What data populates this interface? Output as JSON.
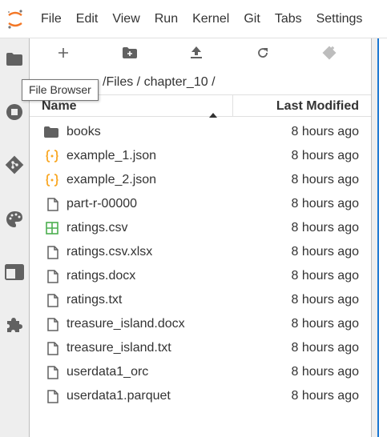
{
  "menubar": {
    "items": [
      "File",
      "Edit",
      "View",
      "Run",
      "Kernel",
      "Git",
      "Tabs",
      "Settings"
    ]
  },
  "sidebar": {
    "icons": [
      "folder-icon",
      "stop-circle-icon",
      "git-icon",
      "palette-icon",
      "tabs-icon",
      "extension-puzzle-icon"
    ]
  },
  "tooltip": {
    "text": "File Browser"
  },
  "toolbar": {
    "icons": [
      "new-launcher-icon",
      "new-folder-icon",
      "upload-icon",
      "refresh-icon",
      "git-clone-icon"
    ]
  },
  "breadcrumb": {
    "path": "/Files / chapter_10 /"
  },
  "listing": {
    "header": {
      "name": "Name",
      "modified": "Last Modified"
    },
    "files": [
      {
        "name": "books",
        "modified": "8 hours ago",
        "type": "folder"
      },
      {
        "name": "example_1.json",
        "modified": "8 hours ago",
        "type": "json"
      },
      {
        "name": "example_2.json",
        "modified": "8 hours ago",
        "type": "json"
      },
      {
        "name": "part-r-00000",
        "modified": "8 hours ago",
        "type": "file"
      },
      {
        "name": "ratings.csv",
        "modified": "8 hours ago",
        "type": "csv"
      },
      {
        "name": "ratings.csv.xlsx",
        "modified": "8 hours ago",
        "type": "file"
      },
      {
        "name": "ratings.docx",
        "modified": "8 hours ago",
        "type": "file"
      },
      {
        "name": "ratings.txt",
        "modified": "8 hours ago",
        "type": "file"
      },
      {
        "name": "treasure_island.docx",
        "modified": "8 hours ago",
        "type": "file"
      },
      {
        "name": "treasure_island.txt",
        "modified": "8 hours ago",
        "type": "file"
      },
      {
        "name": "userdata1_orc",
        "modified": "8 hours ago",
        "type": "file"
      },
      {
        "name": "userdata1.parquet",
        "modified": "8 hours ago",
        "type": "file"
      }
    ]
  },
  "colors": {
    "accent": "#1976d2",
    "logo": "#f37726",
    "json": "#f9a825",
    "csv": "#4caf50",
    "icon": "#616161"
  }
}
